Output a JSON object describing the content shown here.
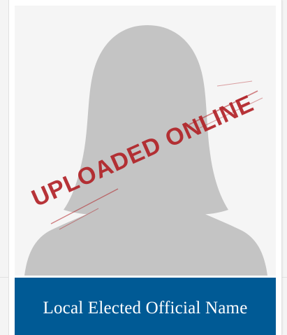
{
  "profile": {
    "name": "Local Elected Official Name",
    "stamp_text": "UPLOADED ONLINE",
    "avatar_icon": "female-silhouette-placeholder"
  },
  "colors": {
    "name_bar": "#005a95",
    "stamp": "#b11f24",
    "silhouette": "#c4c4c4",
    "photo_background": "#f5f5f5"
  }
}
